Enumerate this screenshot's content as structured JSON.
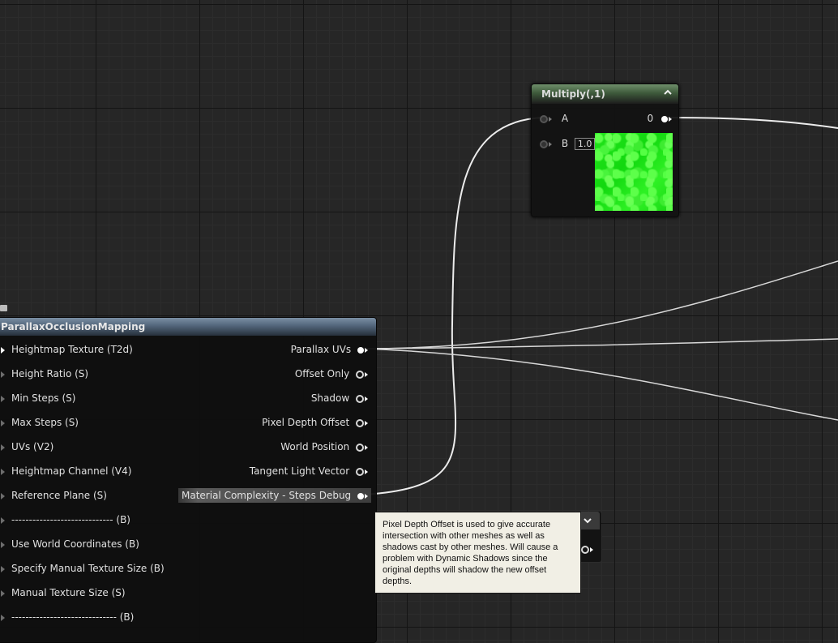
{
  "multiply_node": {
    "title": "Multiply(,1)",
    "input_a": "A",
    "input_b": "B",
    "b_value": "1.0",
    "output_label": "0",
    "header_color": "#4d6b49",
    "preview_color": "#1fe018"
  },
  "pom_node": {
    "title": "ParallaxOcclusionMapping",
    "header_color": "#5b6f85",
    "inputs": [
      "Heightmap Texture (T2d)",
      "Height Ratio (S)",
      "Min Steps (S)",
      "Max Steps (S)",
      "UVs (V2)",
      "Heightmap Channel (V4)",
      "Reference Plane (S)",
      "----------------------------- (B)",
      "Use World Coordinates (B)",
      "Specify Manual Texture Size (B)",
      "Manual Texture Size (S)",
      "------------------------------ (B)"
    ],
    "outputs": [
      "Parallax UVs",
      "Offset Only",
      "Shadow",
      "Pixel Depth Offset",
      "World Position",
      "Tangent Light Vector",
      "Material Complexity - Steps Debug"
    ]
  },
  "tooltip": {
    "text": "Pixel Depth Offset is used to give accurate intersection with other meshes as well as shadows cast by other meshes. Will cause a problem with Dynamic Shadows since the original depths will shadow the new offset depths."
  },
  "wire_color": "#f0f0f0"
}
